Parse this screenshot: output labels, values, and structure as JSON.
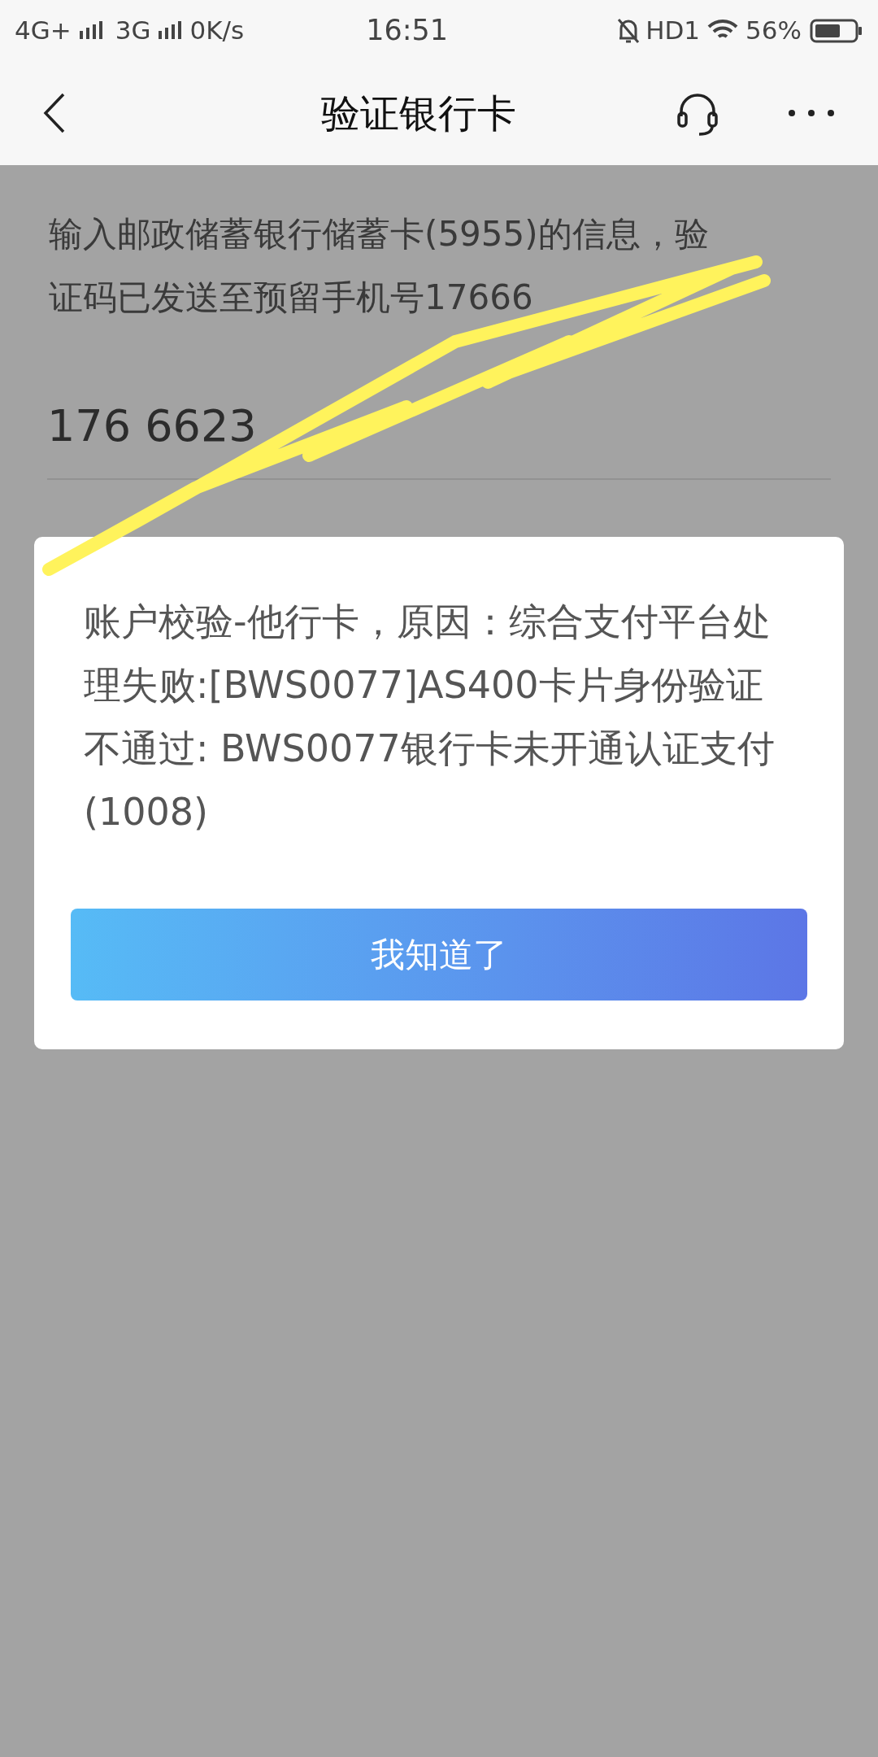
{
  "status_bar": {
    "network_1": "4G+",
    "network_2": "3G",
    "speed": "0K/s",
    "time": "16:51",
    "hd": "HD1",
    "battery": "56%"
  },
  "nav_bar": {
    "title": "验证银行卡"
  },
  "intro_lines": [
    "输入邮政储蓄银行储蓄卡(5955)的信息，验",
    "证码已发送至预留手机号17666"
  ],
  "phone_field": {
    "value": "176 6623"
  },
  "dialog": {
    "message": "账户校验-他行卡，原因：综合支付平台处理失败:[BWS0077]AS400卡片身份验证不通过: BWS0077银行卡未开通认证支付(1008)",
    "button": "我知道了"
  }
}
